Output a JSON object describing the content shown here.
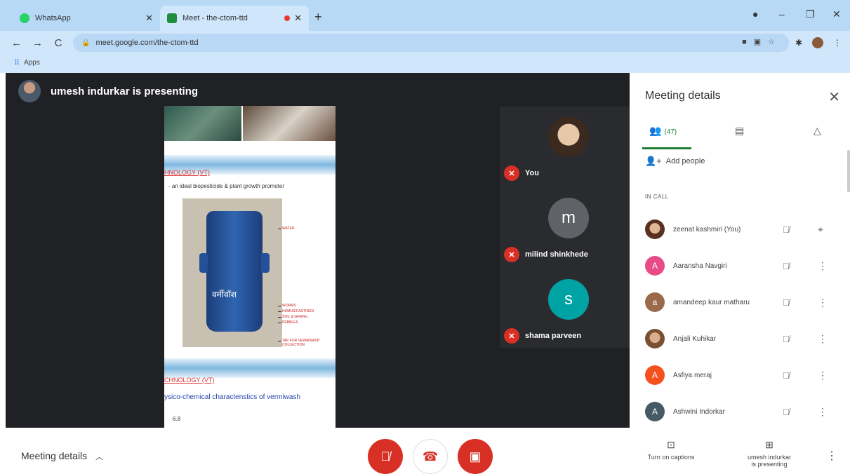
{
  "browser": {
    "tabs": [
      {
        "title": "WhatsApp",
        "fav_color": "#25d366"
      },
      {
        "title": "Meet - the-ctom-ttd",
        "fav_color": "#1e8e3e"
      }
    ],
    "url": "meet.google.com/the-ctom-ttd",
    "bookmarks_label": "Apps"
  },
  "stage": {
    "presenting_text": "umesh indurkar is presenting",
    "slide": {
      "heading1": "HNOLOGY (VT)",
      "subtitle1": "- an ideal biopesticide & plant growth promoter",
      "annot_water": "WATER",
      "annot_worms": "WORMS",
      "annot_humus": "HUMUS/CASTINGS",
      "annot_soil": "SOIL & GRAVEL",
      "annot_pebbles": "PEBBLES",
      "annot_tap": "TAP FOR VERMIWASH COLLECTION",
      "drum_text": "वर्मीवॉश",
      "heading2": "CHNOLOGY (VT)",
      "subtitle2": "ysico-chemical charactenstics of vermiwash",
      "number": "6.8"
    },
    "tiles": [
      {
        "name": "You",
        "initial": "",
        "color": "#e7c9a9"
      },
      {
        "name": "milind shinkhede",
        "initial": "m",
        "color": "#5f6368"
      },
      {
        "name": "shama parveen",
        "initial": "s",
        "color": "#00a3a3"
      }
    ]
  },
  "panel": {
    "title": "Meeting details",
    "people_count": "(47)",
    "add_people": "Add people",
    "in_call": "IN CALL",
    "participants": [
      {
        "name": "zeenat kashmiri (You)",
        "initial": "",
        "color": "#a0674a"
      },
      {
        "name": "Aaransha Navgiri",
        "initial": "A",
        "color": "#e84c88"
      },
      {
        "name": "amandeep kaur matharu",
        "initial": "a",
        "color": "#9a6a4a"
      },
      {
        "name": "Anjali Kuhikar",
        "initial": "",
        "color": "#b98a6a"
      },
      {
        "name": "Asfiya meraj",
        "initial": "A",
        "color": "#f4511e"
      },
      {
        "name": "Ashwini Indorkar",
        "initial": "A",
        "color": "#455a64"
      }
    ]
  },
  "bottom": {
    "meeting_details": "Meeting details",
    "captions": "Turn on captions",
    "presenting_line1": "umesh indurkar",
    "presenting_line2": "is presenting"
  }
}
